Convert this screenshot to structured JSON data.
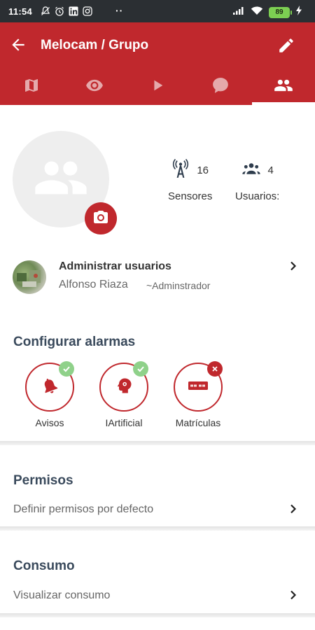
{
  "status_bar": {
    "time": "11:54",
    "dots": "··",
    "battery": "89",
    "icons": [
      "notifications-off-icon",
      "alarm-icon",
      "linkedin-icon",
      "instagram-icon",
      "signal-icon",
      "wifi-icon",
      "battery-icon",
      "charging-icon"
    ]
  },
  "app_bar": {
    "title": "Melocam / Grupo",
    "back_icon": "arrow-back-icon",
    "edit_icon": "pencil-icon",
    "color": "#c0282d"
  },
  "tabs": [
    {
      "icon": "map-icon",
      "active": false
    },
    {
      "icon": "eye-icon",
      "active": false
    },
    {
      "icon": "play-icon",
      "active": false
    },
    {
      "icon": "chat-bubble-icon",
      "active": false
    },
    {
      "icon": "group-icon",
      "active": true
    }
  ],
  "profile": {
    "avatar_icon": "group-avatar-icon",
    "camera_icon": "camera-icon"
  },
  "stats": {
    "sensors": {
      "value": "16",
      "label": "Sensores",
      "icon": "antenna-icon"
    },
    "users": {
      "value": "4",
      "label": "Usuarios:",
      "icon": "people-icon"
    }
  },
  "admin": {
    "title": "Administrar usuarios",
    "name": "Alfonso Riaza",
    "role": "~Adminstrador"
  },
  "alarms": {
    "title": "Configurar alarmas",
    "items": [
      {
        "label": "Avisos",
        "icon": "bell-icon",
        "status": "ok"
      },
      {
        "label": "IArtificial",
        "icon": "ai-brain-icon",
        "status": "ok"
      },
      {
        "label": "Matrículas",
        "icon": "license-plate-icon",
        "status": "error"
      }
    ]
  },
  "permissions": {
    "title": "Permisos",
    "row": "Definir permisos por defecto"
  },
  "consumption": {
    "title": "Consumo",
    "row": "Visualizar consumo"
  }
}
